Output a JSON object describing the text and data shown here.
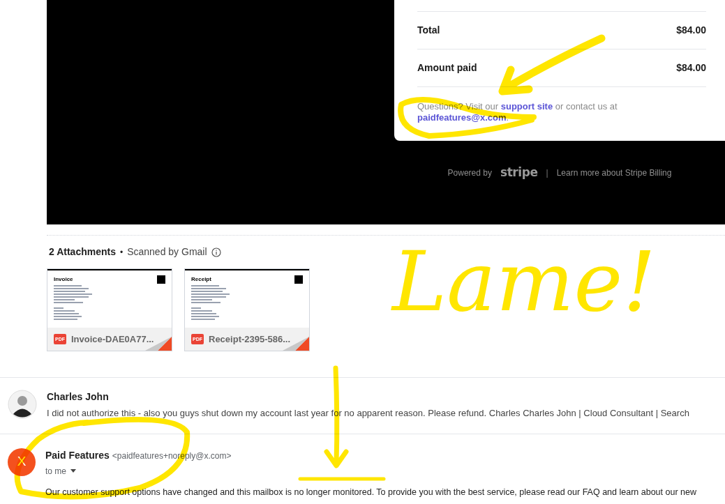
{
  "receipt": {
    "rows": [
      {
        "label": "Total",
        "value": "$84.00"
      },
      {
        "label": "Amount paid",
        "value": "$84.00"
      }
    ],
    "questions": {
      "prefix": "Questions? Visit our ",
      "support_link": "support site",
      "middle": " or contact us at ",
      "email_link": "paidfeatures@x.com",
      "suffix": "."
    },
    "footer": {
      "powered_by": "Powered by",
      "logo": "stripe",
      "separator": "|",
      "learn_more": "Learn more about Stripe Billing"
    }
  },
  "attachments": {
    "count_label": "2 Attachments",
    "separator": "•",
    "scanned": "Scanned by Gmail",
    "files": [
      {
        "title": "Invoice",
        "filename": "Invoice-DAE0A77...",
        "badge": "PDF"
      },
      {
        "title": "Receipt",
        "filename": "Receipt-2395-586...",
        "badge": "PDF"
      }
    ]
  },
  "messages": [
    {
      "kind": "photo",
      "sender": "Charles John",
      "snippet": "I did not authorize this - also you guys shut down my account last year for no apparent reason. Please refund. Charles Charles John | Cloud Consultant | Search"
    },
    {
      "kind": "letter",
      "initial": "X",
      "sender": "Paid Features",
      "address": "<paidfeatures+noreply@x.com>",
      "recipient": "to me",
      "body": "Our customer support options have changed and this mailbox is no longer monitored. To provide you with the best service, please read our FAQ and learn about our new"
    }
  ],
  "annotations": [
    {
      "kind": "arrow"
    },
    {
      "kind": "circle"
    },
    {
      "kind": "note",
      "text": "Lame!"
    },
    {
      "kind": "down-arrow"
    },
    {
      "kind": "circle-large"
    },
    {
      "kind": "underline"
    }
  ]
}
